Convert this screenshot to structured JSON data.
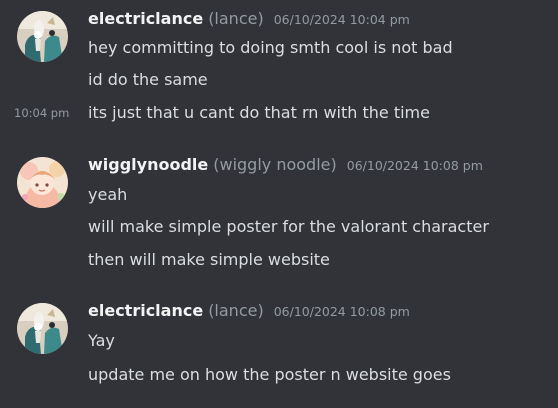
{
  "messages": [
    {
      "author": "electriclance",
      "nickname": "(lance)",
      "timestamp": "06/10/2024 10:04 pm",
      "avatar_icon": "anime-character-avatar-icon",
      "lines": [
        "hey committing to doing smth cool is not bad",
        "id do the same",
        "its just that u cant do that rn with the time"
      ],
      "hover_time": "10:04 pm"
    },
    {
      "author": "wigglynoodle",
      "nickname": "(wiggly noodle)",
      "timestamp": "06/10/2024 10:08 pm",
      "avatar_icon": "pastel-character-avatar-icon",
      "lines": [
        "yeah",
        "will make simple poster for the valorant character",
        "then will make simple website"
      ]
    },
    {
      "author": "electriclance",
      "nickname": "(lance)",
      "timestamp": "06/10/2024 10:08 pm",
      "avatar_icon": "anime-character-avatar-icon",
      "lines": [
        "Yay",
        "update me on how the poster n website goes"
      ]
    }
  ],
  "colors": {
    "background": "#313338",
    "username": "#f2f3f5",
    "muted": "#949ba4",
    "message_text": "#dbdee1"
  }
}
